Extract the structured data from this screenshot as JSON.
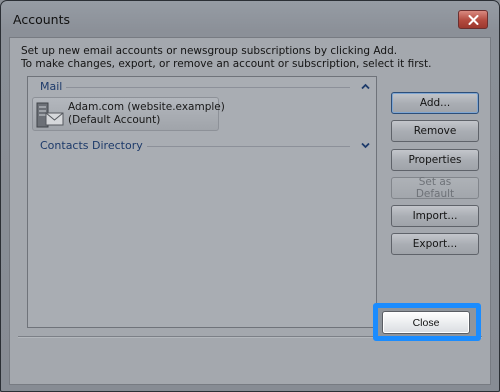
{
  "window": {
    "title": "Accounts",
    "close_icon": "close-icon"
  },
  "instructions": {
    "line1": "Set up new email accounts or newsgroup subscriptions by clicking Add.",
    "line2": "To make changes, export, or remove an account or subscription, select it first."
  },
  "account_list": {
    "groups": [
      {
        "name": "Mail",
        "state": "expanded",
        "chevron": "chevron-up-icon"
      },
      {
        "name": "Contacts Directory",
        "state": "collapsed",
        "chevron": "chevron-down-icon"
      }
    ],
    "accounts": [
      {
        "name": "Adam.com (website.example)",
        "detail": "(Default Account)",
        "icon": "mail-server-icon"
      }
    ]
  },
  "buttons": {
    "add": "Add...",
    "remove": "Remove",
    "properties": "Properties",
    "set_default": "Set as Default",
    "import": "Import...",
    "export": "Export...",
    "close": "Close"
  },
  "colors": {
    "highlight": "#1a8cff",
    "group_header_text": "#1d3a6a"
  }
}
